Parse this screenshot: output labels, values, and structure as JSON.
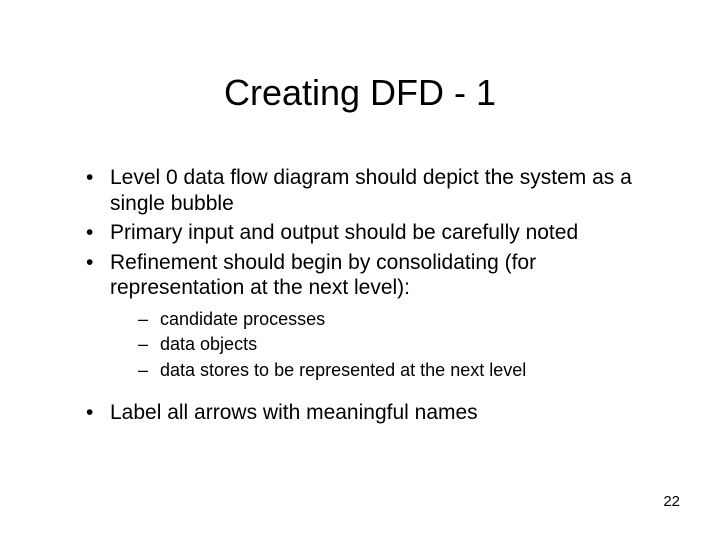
{
  "title": "Creating DFD - 1",
  "bullets": {
    "b1": "Level 0 data flow diagram should depict the system as a single bubble",
    "b2": "Primary input and output should be carefully noted",
    "b3": "Refinement should begin by consolidating (for representation at the next level):",
    "b3_sub": {
      "s1": "candidate processes",
      "s2": "data objects",
      "s3": "data stores to be represented at the next level"
    },
    "b4": "Label all arrows with meaningful names"
  },
  "page_number": "22"
}
